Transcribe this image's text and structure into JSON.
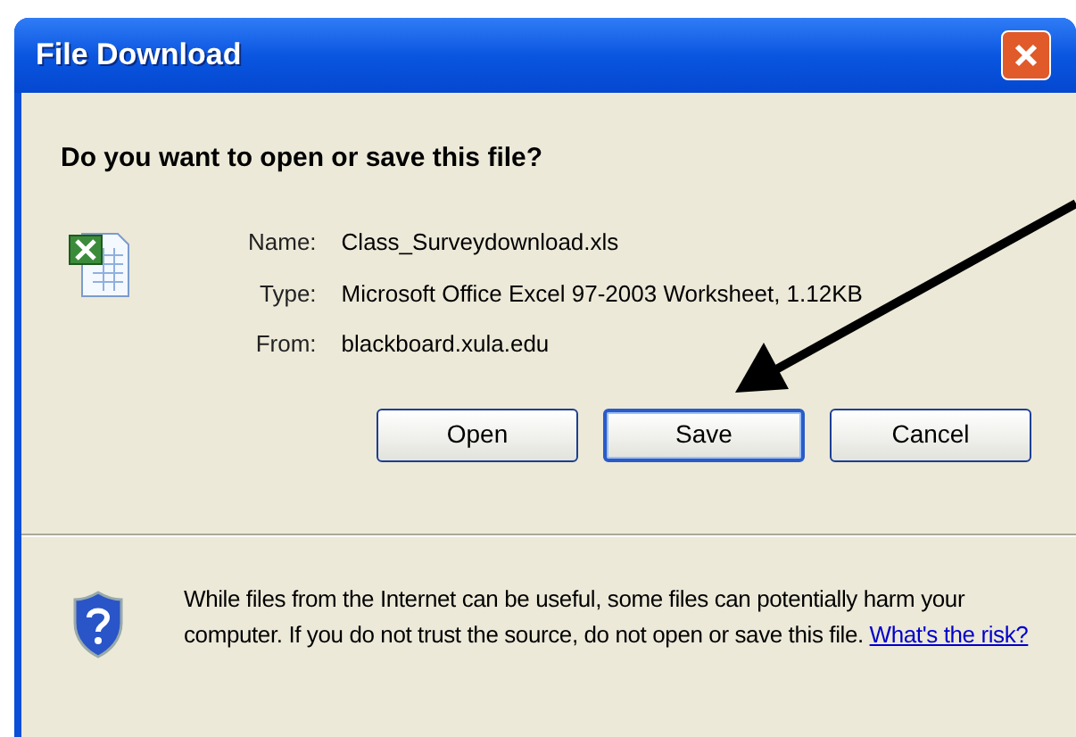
{
  "window": {
    "title": "File Download"
  },
  "question": "Do you want to open or save this file?",
  "details": [
    {
      "label": "Name:",
      "value": "Class_Surveydownload.xls"
    },
    {
      "label": "Type:",
      "value": "Microsoft Office Excel 97-2003 Worksheet, 1.12KB"
    },
    {
      "label": "From:",
      "value": "blackboard.xula.edu"
    }
  ],
  "buttons": [
    {
      "label": "Open",
      "default": false
    },
    {
      "label": "Save",
      "default": true
    },
    {
      "label": "Cancel",
      "default": false
    }
  ],
  "warning": {
    "text": "While files from the Internet can be useful, some files can potentially harm your computer. If you do not trust the source, do not open or save this file.",
    "link": "What's the risk?"
  }
}
